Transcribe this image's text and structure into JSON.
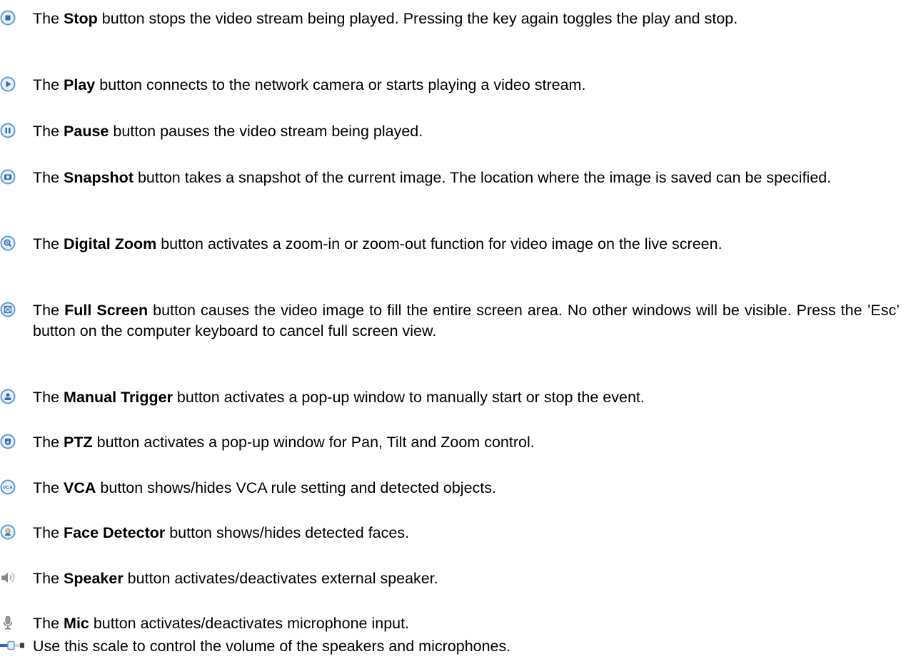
{
  "colors": {
    "icon_ring": "#5b9bd5",
    "icon_fill": "#e9f2fb",
    "icon_glyph": "#2f6fb0",
    "text": "#000000"
  },
  "entries": [
    {
      "icon": "stop-icon",
      "name": "Stop",
      "desc": " button stops the video stream being played. Pressing the key again toggles the play and stop."
    },
    {
      "icon": "play-icon",
      "name": "Play",
      "desc": " button connects to the network camera or starts playing a video stream."
    },
    {
      "icon": "pause-icon",
      "name": "Pause",
      "desc": " button pauses the video stream being played."
    },
    {
      "icon": "snapshot-icon",
      "name": "Snapshot",
      "desc": " button takes a snapshot of the current image. The location where the image is saved can be specified."
    },
    {
      "icon": "digital-zoom-icon",
      "name": "Digital Zoom",
      "desc": " button activates a zoom-in or zoom-out function for video image on the live screen."
    },
    {
      "icon": "full-screen-icon",
      "name": "Full Screen",
      "desc": " button causes the video image to fill the entire screen area. No other windows will be visible. Press the ’Esc’ button on the computer keyboard to cancel full screen view."
    },
    {
      "icon": "manual-trigger-icon",
      "name": "Manual Trigger",
      "desc": " button activates a pop-up window to manually start or stop the event."
    },
    {
      "icon": "ptz-icon",
      "name": "PTZ",
      "desc": " button activates a pop-up window for Pan, Tilt and Zoom control."
    },
    {
      "icon": "vca-icon",
      "name": "VCA",
      "desc": " button shows/hides VCA rule setting and detected objects.",
      "icon_text": "VCA"
    },
    {
      "icon": "face-detector-icon",
      "name": "Face Detector",
      "desc": " button shows/hides detected faces."
    },
    {
      "icon": "speaker-icon",
      "name": "Speaker",
      "desc": " button activates/deactivates external speaker."
    },
    {
      "icon": "mic-icon",
      "name": "Mic",
      "desc": " button activates/deactivates microphone input."
    },
    {
      "icon": "volume-scale-icon",
      "prefix": "Use this scale to control the volume of the speakers and microphones."
    }
  ]
}
